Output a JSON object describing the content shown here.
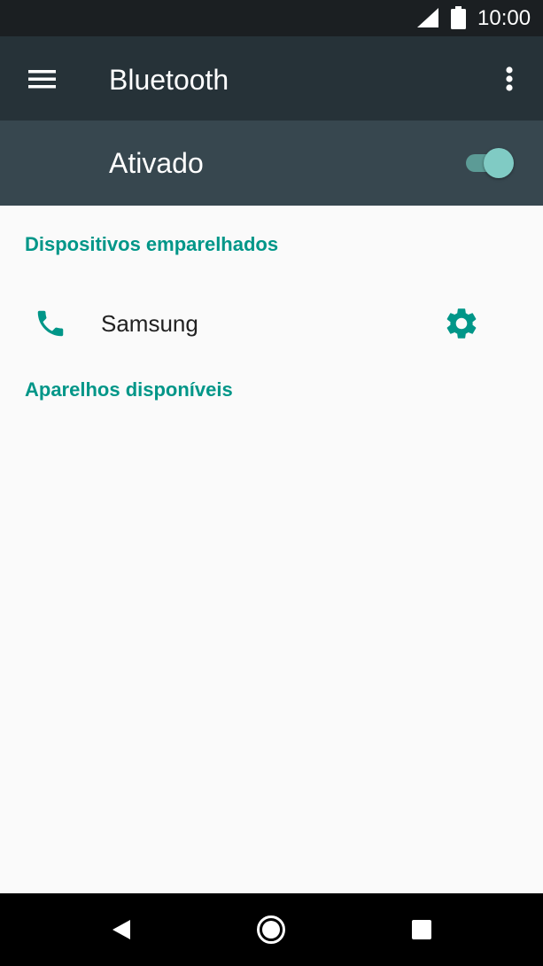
{
  "status_bar": {
    "time": "10:00",
    "icons": [
      "signal-icon",
      "battery-icon"
    ]
  },
  "app_bar": {
    "title": "Bluetooth",
    "menu_icon": "hamburger-menu-icon",
    "overflow_icon": "more-vert-icon"
  },
  "master_switch": {
    "label": "Ativado",
    "checked": true
  },
  "sections": {
    "paired": {
      "header": "Dispositivos emparelhados",
      "devices": [
        {
          "name": "Samsung",
          "icon": "phone-icon",
          "action_icon": "gear-icon"
        }
      ]
    },
    "available": {
      "header": "Aparelhos disponíveis"
    }
  },
  "nav_bar": {
    "icons": [
      "back-icon",
      "home-icon",
      "recents-icon"
    ]
  },
  "colors": {
    "status_bar": "#1b1f22",
    "app_bar": "#263238",
    "switch_bar": "#37474f",
    "accent": "#009688",
    "toggle_thumb": "#80cbc4",
    "background": "#fafafa"
  }
}
